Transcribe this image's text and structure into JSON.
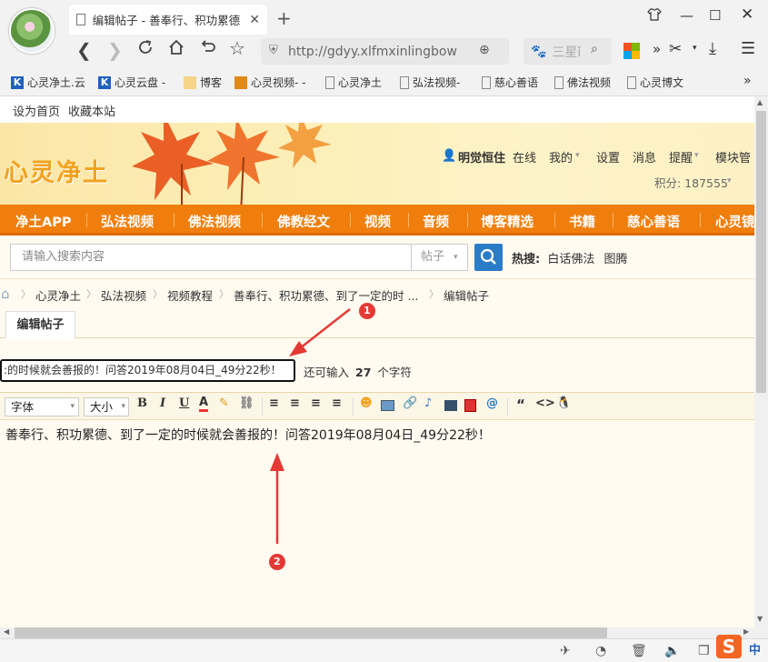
{
  "browser": {
    "tab_title": "编辑帖子 - 善奉行、积功累德",
    "url": "http://gdyy.xlfmxinlingbow",
    "search_placeholder": "三星ǐ",
    "bookmarks": [
      "心灵净土.云",
      "心灵云盘 -",
      "博客",
      "心灵视频- -",
      "心灵净土",
      "弘法视频-",
      "慈心善语",
      "佛法视频",
      "心灵博文"
    ],
    "more_bookmarks": "»"
  },
  "site": {
    "top_links": [
      "设为首页",
      "收藏本站"
    ],
    "logo": "心灵净土",
    "user_name": "明觉恒住",
    "user_status": "在线",
    "user_menu": [
      "我的",
      "设置",
      "消息",
      "提醒",
      "模块管"
    ],
    "points_label": "积分: 187555",
    "nav": [
      "净土APP",
      "弘法视频",
      "佛法视频",
      "佛教经文",
      "视频",
      "音频",
      "博客精选",
      "书籍",
      "慈心善语",
      "心灵镜"
    ],
    "search_placeholder": "请输入搜索内容",
    "search_type": "帖子",
    "hot_label": "热搜:",
    "hot_items": [
      "白话佛法",
      "图腾"
    ],
    "breadcrumbs": [
      "心灵净土",
      "弘法视频",
      "视频教程",
      "善奉行、积功累德、到了一定的时 ...",
      "编辑帖子"
    ]
  },
  "editor": {
    "tab_label": "编辑帖子",
    "title_value": ":的时候就会善报的！问答2019年08月04日_49分22秒！",
    "remain_prefix": "还可输入",
    "remain_count": "27",
    "remain_suffix": "个字符",
    "font_select": "字体",
    "size_select": "大小",
    "body_text": "善奉行、积功累德、到了一定的时候就会善报的！问答2019年08月04日_49分22秒！"
  },
  "annotations": [
    "1",
    "2"
  ],
  "ime": "中",
  "colors": {
    "nav_orange": "#f07e0c",
    "search_blue": "#2a7cc7",
    "annotation_red": "#e53935",
    "logo_orange": "#f2a11e"
  }
}
